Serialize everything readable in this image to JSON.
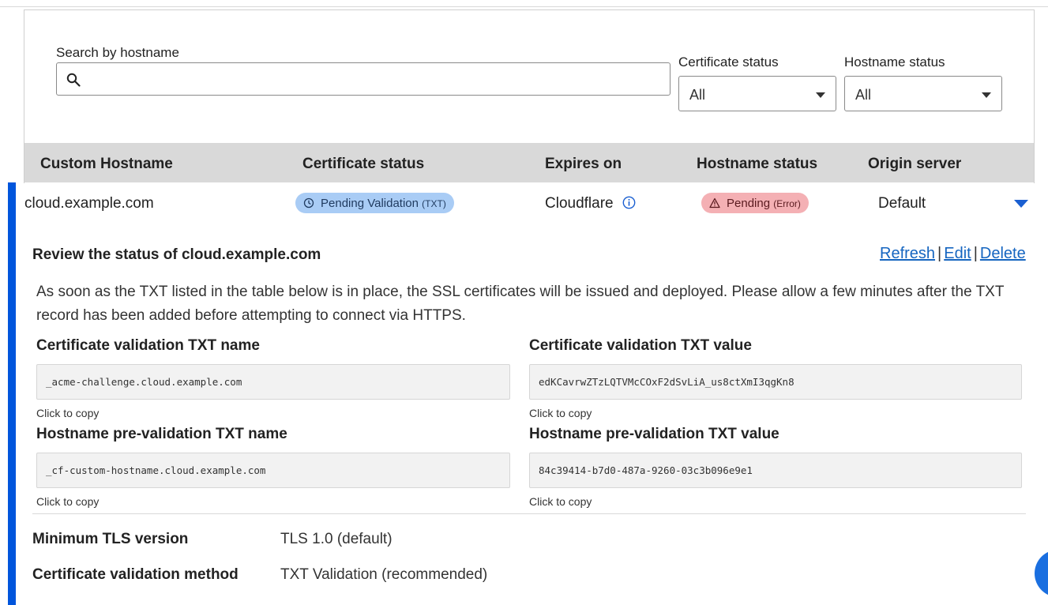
{
  "filters": {
    "search_label": "Search by hostname",
    "search_value": "",
    "search_placeholder": "",
    "cert_status_label": "Certificate status",
    "cert_status_value": "All",
    "hostname_status_label": "Hostname status",
    "hostname_status_value": "All"
  },
  "table": {
    "headers": [
      "Custom Hostname",
      "Certificate status",
      "Expires on",
      "Hostname status",
      "Origin server"
    ]
  },
  "row": {
    "hostname": "cloud.example.com",
    "cert_status": "Pending Validation",
    "cert_status_suffix": "(TXT)",
    "expires_on": "Cloudflare",
    "hostname_status": "Pending",
    "hostname_status_suffix": "(Error)",
    "origin_server": "Default"
  },
  "detail": {
    "title": "Review the status of cloud.example.com",
    "actions": {
      "refresh": "Refresh",
      "edit": "Edit",
      "delete": "Delete",
      "separator": "|"
    },
    "description": "As soon as the TXT listed in the table below is in place, the SSL certificates will be issued and deployed. Please allow a few minutes after the TXT record has been added before attempting to connect via HTTPS.",
    "fields": {
      "cert_txt_name_label": "Certificate validation TXT name",
      "cert_txt_name_value": "_acme-challenge.cloud.example.com",
      "cert_txt_value_label": "Certificate validation TXT value",
      "cert_txt_value_value": "edKCavrwZTzLQTVMcCOxF2dSvLiA_us8ctXmI3qgKn8",
      "pre_txt_name_label": "Hostname pre-validation TXT name",
      "pre_txt_name_value": "_cf-custom-hostname.cloud.example.com",
      "pre_txt_value_label": "Hostname pre-validation TXT value",
      "pre_txt_value_value": "84c39414-b7d0-487a-9260-03c3b096e9e1",
      "copy_hint": "Click to copy"
    },
    "settings": [
      {
        "label": "Minimum TLS version",
        "value": "TLS 1.0 (default)"
      },
      {
        "label": "Certificate validation method",
        "value": "TXT Validation (recommended)"
      }
    ]
  },
  "colors": {
    "accent": "#0055dc",
    "link": "#1565c0",
    "badge_blue": "#a9ccf5",
    "badge_red": "#f4b0b4"
  },
  "icons": {
    "search": "search-icon",
    "clock": "clock-icon",
    "info": "info-icon",
    "warning": "warning-icon",
    "expand": "chevron-down-icon"
  }
}
